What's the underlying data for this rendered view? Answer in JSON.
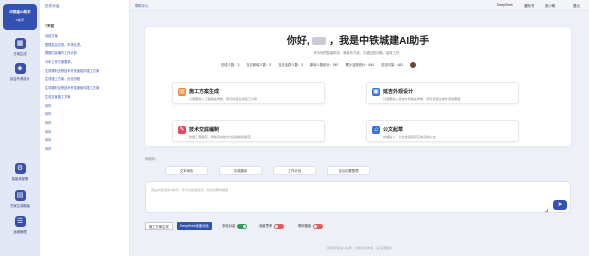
{
  "sidebar": {
    "logo_line1": "中铁建AI助手",
    "logo_line2": "AI助手",
    "items": [
      {
        "label": "方案生成",
        "icon": "grid-icon"
      },
      {
        "label": "延吉外观设计",
        "icon": "palette-icon"
      },
      {
        "label": "智能体配置",
        "icon": "gear-icon"
      },
      {
        "label": "方案生成模板",
        "icon": "template-icon"
      },
      {
        "label": "运维管理",
        "icon": "stack-icon"
      }
    ]
  },
  "history": {
    "title": "历史对话",
    "section": "7天前",
    "items": [
      "请给方案",
      "整理会议记录，市场比重。",
      "根据内容编写工作计划",
      "今年工作方案要求。",
      "生成顺利交桥技术开发面组件施工方案",
      "生成施工方案，优化流程",
      "生成顺利交桥技术开发面组件施工方案",
      "生成方案施工方案",
      "你好",
      "你好",
      "你好",
      "你好",
      "你好",
      "你好"
    ]
  },
  "topbar": {
    "help": "帮助中心",
    "deepseek": "DeepSeek",
    "notice": "通知书",
    "user": "张小明",
    "logout": "退出"
  },
  "main": {
    "greeting_prefix": "你好,",
    "greeting_suffix": "，我是中铁城建AI助手",
    "subtitle": "作为你的智能助手，我能写方案，又能回答问题，高效工作。",
    "stats": [
      "在线人数：3",
      "当日新增人数：3",
      "当日活跃人数：3",
      "新增人数统计：567",
      "累计活跃统计：654",
      "总访问量：463"
    ],
    "cards": [
      {
        "title": "施工方案生成",
        "desc": "只需要输入工程相关参数，即可快速生成施工方案",
        "icon": "document-icon",
        "color": "#f08a3c"
      },
      {
        "title": "延吉外观设计",
        "desc": "只需要输入延吉外观相关参数，即可快速生成外观效果图",
        "icon": "image-icon",
        "color": "#3a74d8"
      },
      {
        "title": "技术交底编制",
        "desc": "依据工程规范，帮助完成技术交底编制和规范",
        "icon": "book-icon",
        "color": "#e24b5b"
      },
      {
        "title": "公文起草",
        "desc": "依据输入，公文快速起草高效完成公文",
        "icon": "bell-icon",
        "color": "#3a74d8"
      }
    ]
  },
  "quick": {
    "label": "你想问：",
    "buttons": [
      "文本润色",
      "中英翻译",
      "工作计划",
      "会议纪要整理"
    ]
  },
  "input": {
    "placeholder": "我是中铁城建AI助手，你可以给我提问，然后我帮你解答"
  },
  "options": {
    "construction": "施工方案生成",
    "deepseek": "DeepSeek深度对话",
    "multiturn": "多轮对话",
    "deepthink": "深度思考",
    "websearch": "联网搜索",
    "multiturn_on": true,
    "deepthink_on": false,
    "websearch_on": false
  },
  "footer": "所有回答由AI生成，内容仅供参考，请仔细甄别"
}
